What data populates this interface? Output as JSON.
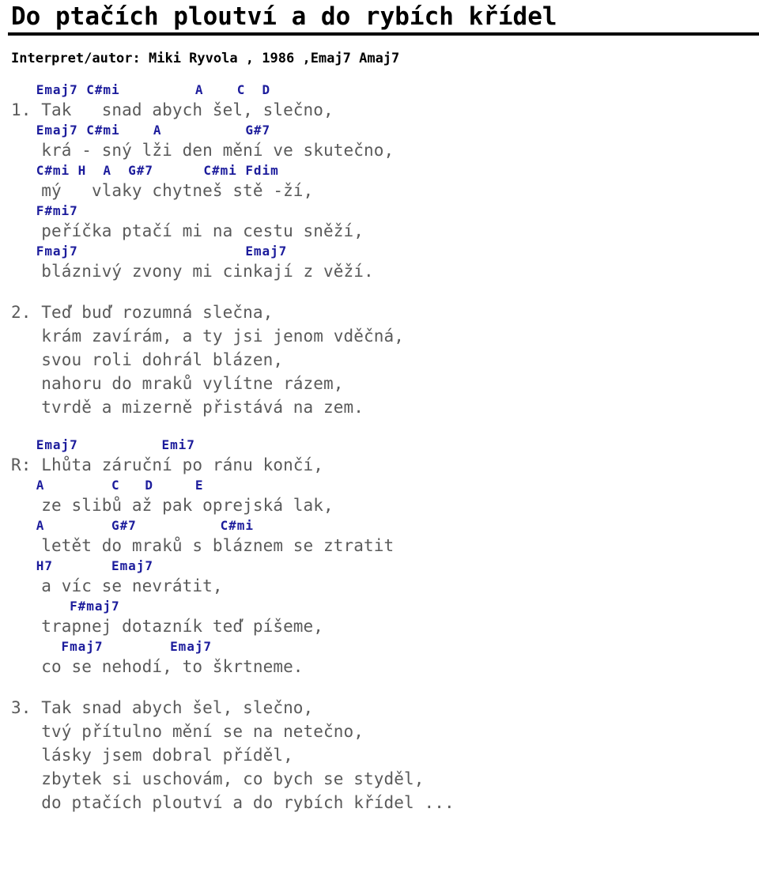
{
  "document": {
    "title": "Do ptačích ploutví a do rybích křídel",
    "byline": "Interpret/autor: Miki Ryvola , 1986 ,Emaj7 Amaj7",
    "colors": {
      "chord": "#1c1c9c",
      "lyric": "#5a5a5a",
      "title": "#000000",
      "rule": "#000000",
      "background": "#ffffff"
    }
  },
  "blocks": [
    {
      "id": "verse-1",
      "kind": "verse",
      "number": "1.",
      "lines": [
        {
          "type": "chord",
          "text": "   Emaj7 C#mi         A    C  D"
        },
        {
          "type": "lyric",
          "text": "1. Tak   snad abych šel, slečno,"
        },
        {
          "type": "chord",
          "text": "   Emaj7 C#mi    A          G#7"
        },
        {
          "type": "lyric",
          "text": "   krá - sný lži den mění ve skutečno,"
        },
        {
          "type": "chord",
          "text": "   C#mi H  A  G#7      C#mi Fdim"
        },
        {
          "type": "lyric",
          "text": "   mý   vlaky chytneš stě -ží,"
        },
        {
          "type": "chord",
          "text": "   F#mi7"
        },
        {
          "type": "lyric",
          "text": "   peříčka ptačí mi na cestu sněží,"
        },
        {
          "type": "chord",
          "text": "   Fmaj7                    Emaj7"
        },
        {
          "type": "lyric",
          "text": "   bláznivý zvony mi cinkají z věží."
        }
      ]
    },
    {
      "id": "verse-2",
      "kind": "verse",
      "number": "2.",
      "lines": [
        {
          "type": "lyric",
          "text": "2. Teď buď rozumná slečna,"
        },
        {
          "type": "lyric",
          "text": "   krám zavírám, a ty jsi jenom vděčná,"
        },
        {
          "type": "lyric",
          "text": "   svou roli dohrál blázen,"
        },
        {
          "type": "lyric",
          "text": "   nahoru do mraků vylítne rázem,"
        },
        {
          "type": "lyric",
          "text": "   tvrdě a mizerně přistává na zem."
        }
      ]
    },
    {
      "id": "refrain",
      "kind": "refrain",
      "number": "R:",
      "lines": [
        {
          "type": "chord",
          "text": "   Emaj7          Emi7"
        },
        {
          "type": "lyric",
          "text": "R: Lhůta záruční po ránu končí,"
        },
        {
          "type": "chord",
          "text": "   A        C   D     E"
        },
        {
          "type": "lyric",
          "text": "   ze slibů až pak oprejská lak,"
        },
        {
          "type": "chord",
          "text": "   A        G#7          C#mi"
        },
        {
          "type": "lyric",
          "text": "   letět do mraků s bláznem se ztratit"
        },
        {
          "type": "chord",
          "text": "   H7       Emaj7"
        },
        {
          "type": "lyric",
          "text": "   a víc se nevrátit,"
        },
        {
          "type": "chord",
          "text": "       F#maj7"
        },
        {
          "type": "lyric",
          "text": "   trapnej dotazník teď píšeme,"
        },
        {
          "type": "chord",
          "text": "      Fmaj7        Emaj7"
        },
        {
          "type": "lyric",
          "text": "   co se nehodí, to škrtneme."
        }
      ]
    },
    {
      "id": "verse-3",
      "kind": "verse",
      "number": "3.",
      "lines": [
        {
          "type": "lyric",
          "text": "3. Tak snad abych šel, slečno,"
        },
        {
          "type": "lyric",
          "text": "   tvý přítulno mění se na netečno,"
        },
        {
          "type": "lyric",
          "text": "   lásky jsem dobral příděl,"
        },
        {
          "type": "lyric",
          "text": "   zbytek si uschovám, co bych se styděl,"
        },
        {
          "type": "lyric",
          "text": "   do ptačích ploutví a do rybích křídel ..."
        }
      ]
    }
  ]
}
